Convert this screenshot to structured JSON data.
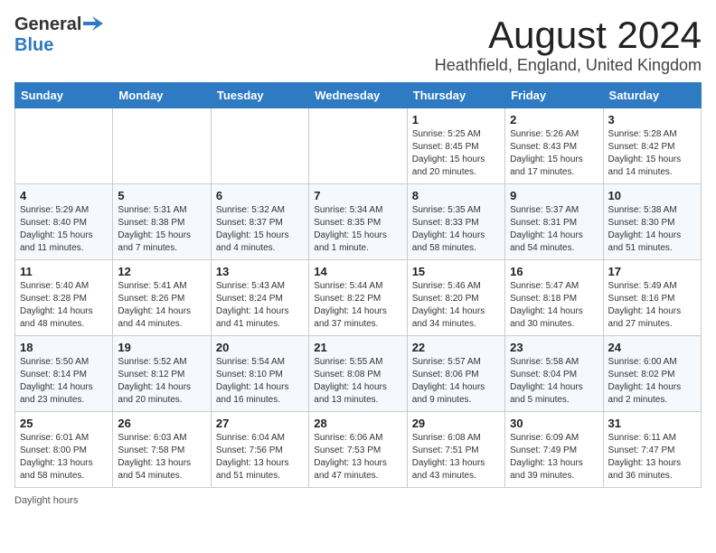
{
  "header": {
    "logo_general": "General",
    "logo_blue": "Blue",
    "month_title": "August 2024",
    "location": "Heathfield, England, United Kingdom"
  },
  "days_of_week": [
    "Sunday",
    "Monday",
    "Tuesday",
    "Wednesday",
    "Thursday",
    "Friday",
    "Saturday"
  ],
  "footer": {
    "daylight_label": "Daylight hours"
  },
  "weeks": [
    {
      "days": [
        {
          "num": "",
          "info": ""
        },
        {
          "num": "",
          "info": ""
        },
        {
          "num": "",
          "info": ""
        },
        {
          "num": "",
          "info": ""
        },
        {
          "num": "1",
          "info": "Sunrise: 5:25 AM\nSunset: 8:45 PM\nDaylight: 15 hours and 20 minutes."
        },
        {
          "num": "2",
          "info": "Sunrise: 5:26 AM\nSunset: 8:43 PM\nDaylight: 15 hours and 17 minutes."
        },
        {
          "num": "3",
          "info": "Sunrise: 5:28 AM\nSunset: 8:42 PM\nDaylight: 15 hours and 14 minutes."
        }
      ]
    },
    {
      "days": [
        {
          "num": "4",
          "info": "Sunrise: 5:29 AM\nSunset: 8:40 PM\nDaylight: 15 hours and 11 minutes."
        },
        {
          "num": "5",
          "info": "Sunrise: 5:31 AM\nSunset: 8:38 PM\nDaylight: 15 hours and 7 minutes."
        },
        {
          "num": "6",
          "info": "Sunrise: 5:32 AM\nSunset: 8:37 PM\nDaylight: 15 hours and 4 minutes."
        },
        {
          "num": "7",
          "info": "Sunrise: 5:34 AM\nSunset: 8:35 PM\nDaylight: 15 hours and 1 minute."
        },
        {
          "num": "8",
          "info": "Sunrise: 5:35 AM\nSunset: 8:33 PM\nDaylight: 14 hours and 58 minutes."
        },
        {
          "num": "9",
          "info": "Sunrise: 5:37 AM\nSunset: 8:31 PM\nDaylight: 14 hours and 54 minutes."
        },
        {
          "num": "10",
          "info": "Sunrise: 5:38 AM\nSunset: 8:30 PM\nDaylight: 14 hours and 51 minutes."
        }
      ]
    },
    {
      "days": [
        {
          "num": "11",
          "info": "Sunrise: 5:40 AM\nSunset: 8:28 PM\nDaylight: 14 hours and 48 minutes."
        },
        {
          "num": "12",
          "info": "Sunrise: 5:41 AM\nSunset: 8:26 PM\nDaylight: 14 hours and 44 minutes."
        },
        {
          "num": "13",
          "info": "Sunrise: 5:43 AM\nSunset: 8:24 PM\nDaylight: 14 hours and 41 minutes."
        },
        {
          "num": "14",
          "info": "Sunrise: 5:44 AM\nSunset: 8:22 PM\nDaylight: 14 hours and 37 minutes."
        },
        {
          "num": "15",
          "info": "Sunrise: 5:46 AM\nSunset: 8:20 PM\nDaylight: 14 hours and 34 minutes."
        },
        {
          "num": "16",
          "info": "Sunrise: 5:47 AM\nSunset: 8:18 PM\nDaylight: 14 hours and 30 minutes."
        },
        {
          "num": "17",
          "info": "Sunrise: 5:49 AM\nSunset: 8:16 PM\nDaylight: 14 hours and 27 minutes."
        }
      ]
    },
    {
      "days": [
        {
          "num": "18",
          "info": "Sunrise: 5:50 AM\nSunset: 8:14 PM\nDaylight: 14 hours and 23 minutes."
        },
        {
          "num": "19",
          "info": "Sunrise: 5:52 AM\nSunset: 8:12 PM\nDaylight: 14 hours and 20 minutes."
        },
        {
          "num": "20",
          "info": "Sunrise: 5:54 AM\nSunset: 8:10 PM\nDaylight: 14 hours and 16 minutes."
        },
        {
          "num": "21",
          "info": "Sunrise: 5:55 AM\nSunset: 8:08 PM\nDaylight: 14 hours and 13 minutes."
        },
        {
          "num": "22",
          "info": "Sunrise: 5:57 AM\nSunset: 8:06 PM\nDaylight: 14 hours and 9 minutes."
        },
        {
          "num": "23",
          "info": "Sunrise: 5:58 AM\nSunset: 8:04 PM\nDaylight: 14 hours and 5 minutes."
        },
        {
          "num": "24",
          "info": "Sunrise: 6:00 AM\nSunset: 8:02 PM\nDaylight: 14 hours and 2 minutes."
        }
      ]
    },
    {
      "days": [
        {
          "num": "25",
          "info": "Sunrise: 6:01 AM\nSunset: 8:00 PM\nDaylight: 13 hours and 58 minutes."
        },
        {
          "num": "26",
          "info": "Sunrise: 6:03 AM\nSunset: 7:58 PM\nDaylight: 13 hours and 54 minutes."
        },
        {
          "num": "27",
          "info": "Sunrise: 6:04 AM\nSunset: 7:56 PM\nDaylight: 13 hours and 51 minutes."
        },
        {
          "num": "28",
          "info": "Sunrise: 6:06 AM\nSunset: 7:53 PM\nDaylight: 13 hours and 47 minutes."
        },
        {
          "num": "29",
          "info": "Sunrise: 6:08 AM\nSunset: 7:51 PM\nDaylight: 13 hours and 43 minutes."
        },
        {
          "num": "30",
          "info": "Sunrise: 6:09 AM\nSunset: 7:49 PM\nDaylight: 13 hours and 39 minutes."
        },
        {
          "num": "31",
          "info": "Sunrise: 6:11 AM\nSunset: 7:47 PM\nDaylight: 13 hours and 36 minutes."
        }
      ]
    }
  ]
}
